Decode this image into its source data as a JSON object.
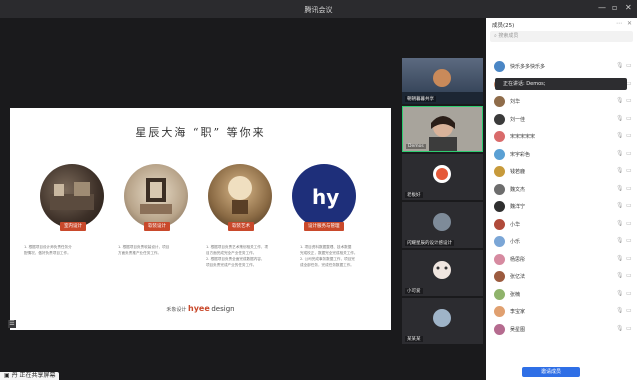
{
  "window": {
    "title": "腾讯会议",
    "minimize": "—",
    "maximize": "▫",
    "close": "✕"
  },
  "slide": {
    "title": "星辰大海 “职” 等你来",
    "cards": [
      {
        "tag": "室内设计",
        "desc": [
          "1. 根据项目设计师负责任务分",
          "配情况，做好负责项目工作。"
        ]
      },
      {
        "tag": "软装设计",
        "desc": [
          "1. 根据项目负责软装设计，项目",
          "方面负责推产业任务工作。"
        ]
      },
      {
        "tag": "软装艺术",
        "desc": [
          "1. 根据项目负责艺术策划相关工作，项",
          "目方面完成完全产业任务工作。",
          "2. 根据项目负责全面完成数据内容，",
          "项目负责完成产业的任务工作。"
        ]
      },
      {
        "tag": "设计服务与管理",
        "desc": [
          "1. 项目资料数据整理、技术数据",
          "完成校正，数据完全完成相关工作。",
          "2. 公司完成事务数据工作，项目完",
          "成全部任务，完成任务数据工作。"
        ]
      }
    ],
    "brand_prefix": "禾象设计",
    "brand_logo": "hyee",
    "brand_suffix": "design"
  },
  "share_bar": "▣ 丹 正在共享屏幕",
  "videos": [
    {
      "name": "朝朝暮暮共享"
    },
    {
      "name": "Demos"
    },
    {
      "name": "老板好"
    },
    {
      "name": "闪耀星辰的设计感设计"
    },
    {
      "name": "小可爱"
    },
    {
      "name": "某某某"
    }
  ],
  "panel": {
    "title": "成员(25)",
    "search_placeholder": "搜索成员",
    "tip": "正在讲话: Demos;",
    "members": [
      {
        "name": "快乐多多快乐多",
        "color": "#4a86c5"
      },
      {
        "name": "李吴宇",
        "color": "#c98b6a"
      },
      {
        "name": "刘华",
        "color": "#8f6c4a"
      },
      {
        "name": "刘一佳",
        "color": "#3b3b3b"
      },
      {
        "name": "宋宋宋宋宋",
        "color": "#d96b6b"
      },
      {
        "name": "宋宇彩色",
        "color": "#5aa0d4"
      },
      {
        "name": "钱若鹿",
        "color": "#c79a3b"
      },
      {
        "name": "魏文杰",
        "color": "#6d6d6d"
      },
      {
        "name": "魏洋宁",
        "color": "#2f2f2f"
      },
      {
        "name": "小华",
        "color": "#b04a3a"
      },
      {
        "name": "小乐",
        "color": "#7ba6d6"
      },
      {
        "name": "杨思彤",
        "color": "#d68aa0"
      },
      {
        "name": "张亿法",
        "color": "#9c5b3f"
      },
      {
        "name": "张楠",
        "color": "#8fb36b"
      },
      {
        "name": "李宝家",
        "color": "#e0a070"
      },
      {
        "name": "吴星图",
        "color": "#b56b8f"
      }
    ],
    "invite_button": "邀请成员"
  }
}
